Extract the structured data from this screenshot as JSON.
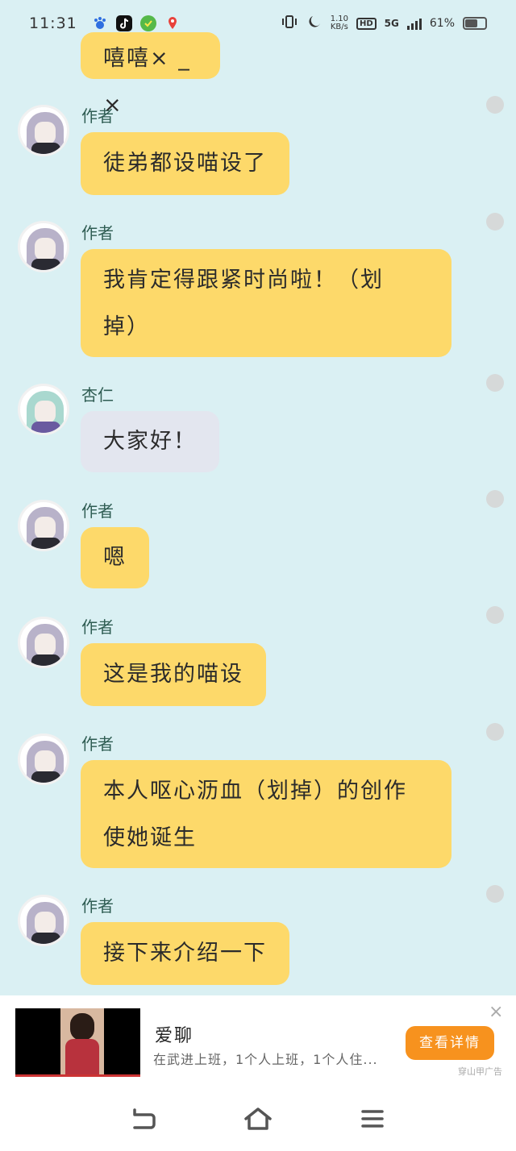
{
  "status_bar": {
    "time": "11:31",
    "apps": [
      "baidu-icon",
      "tiktok-icon",
      "wechat-pay-icon",
      "maps-icon"
    ],
    "net_speed_value": "1.10",
    "net_speed_unit": "KB/s",
    "hd_label": "HD",
    "network": "5G",
    "battery": "61%",
    "battery_level": 0.61
  },
  "messages": [
    {
      "sender": "",
      "text": "嘻嘻× _ ×",
      "style": "yellow",
      "avatar": "none",
      "partial": true
    },
    {
      "sender": "作者",
      "text": "徒弟都设喵设了",
      "style": "yellow",
      "avatar": "purple-hair-girl"
    },
    {
      "sender": "作者",
      "lines": [
        "我肯定得跟紧时尚啦！（划",
        "掉）"
      ],
      "style": "yellow",
      "avatar": "purple-hair-girl"
    },
    {
      "sender": "杏仁",
      "text": "大家好！",
      "style": "gray",
      "avatar": "green-hair-girl"
    },
    {
      "sender": "作者",
      "text": "嗯",
      "style": "yellow",
      "avatar": "purple-hair-girl"
    },
    {
      "sender": "作者",
      "text": "这是我的喵设",
      "style": "yellow",
      "avatar": "purple-hair-girl"
    },
    {
      "sender": "作者",
      "lines": [
        "本人呕心沥血（划掉）的创作",
        "使她诞生"
      ],
      "style": "yellow",
      "avatar": "purple-hair-girl"
    },
    {
      "sender": "作者",
      "text": "接下来介绍一下",
      "style": "yellow",
      "avatar": "purple-hair-girl"
    }
  ],
  "ad": {
    "title": "爱聊",
    "description": "在武进上班，1个人上班，1个人住...",
    "button_label": "查看详情",
    "source": "穿山甲广告",
    "close_symbol": "×"
  },
  "nav": {
    "back": "back-icon",
    "home": "home-icon",
    "menu": "menu-icon"
  },
  "colors": {
    "background": "#daf0f3",
    "bubble_yellow": "#fdd96a",
    "bubble_gray": "#e3e6ef",
    "sender_name": "#2f5d53",
    "ad_button": "#f7921e"
  }
}
